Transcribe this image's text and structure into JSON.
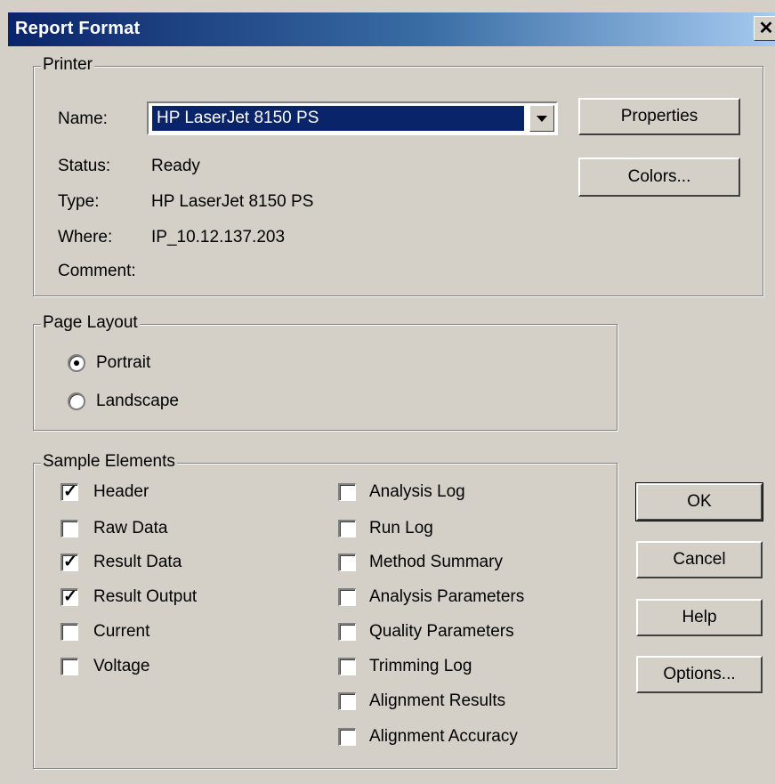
{
  "window": {
    "title": "Report Format",
    "close_glyph": "✕"
  },
  "printer": {
    "legend": "Printer",
    "name_label": "Name:",
    "name_value": "HP LaserJet 8150 PS",
    "status_label": "Status:",
    "status_value": "Ready",
    "type_label": "Type:",
    "type_value": "HP LaserJet 8150 PS",
    "where_label": "Where:",
    "where_value": "IP_10.12.137.203",
    "comment_label": "Comment:",
    "properties_button": "Properties",
    "colors_button": "Colors..."
  },
  "page_layout": {
    "legend": "Page Layout",
    "options": [
      {
        "label": "Portrait",
        "selected": true
      },
      {
        "label": "Landscape",
        "selected": false
      }
    ]
  },
  "sample_elements": {
    "legend": "Sample Elements",
    "left": [
      {
        "label": "Header",
        "checked": true
      },
      {
        "label": "Raw Data",
        "checked": false
      },
      {
        "label": "Result Data",
        "checked": true
      },
      {
        "label": "Result Output",
        "checked": true
      },
      {
        "label": "Current",
        "checked": false
      },
      {
        "label": "Voltage",
        "checked": false
      }
    ],
    "right": [
      {
        "label": "Analysis Log",
        "checked": false
      },
      {
        "label": "Run Log",
        "checked": false
      },
      {
        "label": "Method Summary",
        "checked": false
      },
      {
        "label": "Analysis Parameters",
        "checked": false
      },
      {
        "label": "Quality Parameters",
        "checked": false
      },
      {
        "label": "Trimming Log",
        "checked": false
      },
      {
        "label": "Alignment Results",
        "checked": false
      },
      {
        "label": "Alignment Accuracy",
        "checked": false
      }
    ]
  },
  "buttons": {
    "ok": "OK",
    "cancel": "Cancel",
    "help": "Help",
    "options": "Options..."
  }
}
